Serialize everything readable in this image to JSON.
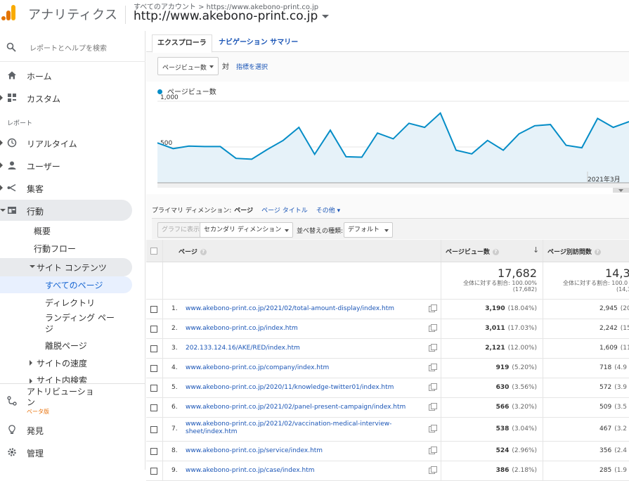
{
  "header": {
    "app_title": "アナリティクス",
    "breadcrumb": "すべてのアカウント > https://www.akebono-print.co.jp",
    "account": "http://www.akebono-print.co.jp"
  },
  "sidebar": {
    "search_placeholder": "レポートとヘルプを検索",
    "home": "ホーム",
    "custom": "カスタム",
    "section_label": "レポート",
    "realtime": "リアルタイム",
    "users": "ユーザー",
    "acquisition": "集客",
    "behavior": "行動",
    "overview": "概要",
    "behavior_flow": "行動フロー",
    "site_content": "サイト コンテンツ",
    "all_pages": "すべてのページ",
    "directory": "ディレクトリ",
    "landing_line1": "ランディング ペー",
    "landing_line2": "ジ",
    "exit_pages": "離脱ページ",
    "site_speed": "サイトの速度",
    "site_search": "サイト内検索",
    "attribution_line1": "アトリビューショ",
    "attribution_line2": "ン",
    "beta": "ベータ版",
    "discover": "発見",
    "admin": "管理"
  },
  "tabs": {
    "explorer": "エクスプローラ",
    "navigation": "ナビゲーション サマリー"
  },
  "metric": {
    "selected": "ページビュー数",
    "vs": "対",
    "select_metric": "指標を選択"
  },
  "chart_data": {
    "type": "line",
    "legend": "ページビュー数",
    "color": "#058dc7",
    "y_ticks": [
      "1,000",
      "500"
    ],
    "ylim": [
      0,
      1000
    ],
    "x_label": "2021年3月",
    "values": [
      490,
      420,
      450,
      445,
      445,
      300,
      290,
      410,
      520,
      680,
      350,
      645,
      320,
      315,
      610,
      540,
      730,
      680,
      855,
      400,
      355,
      520,
      400,
      600,
      700,
      715,
      460,
      430,
      790,
      680,
      750
    ]
  },
  "dims": {
    "label": "プライマリ ディメンション:",
    "current": "ページ",
    "page_title": "ページ タイトル",
    "other": "その他"
  },
  "toolbar": {
    "graph": "グラフに表示",
    "secondary": "セカンダリ ディメンション",
    "sort_label": "並べ替えの種類:",
    "sort_default": "デフォルト"
  },
  "table": {
    "col_page": "ページ",
    "col_pv": "ページビュー数",
    "col_upv": "ページ別訪問数",
    "total_pv": "17,682",
    "total_pv_sub": "全体に対する割合: 100.00%",
    "total_pv_sub2": "(17,682)",
    "total_upv": "14,38",
    "total_upv_sub": "全体に対する割合: 100.0",
    "total_upv_sub2": "(14,3",
    "rows": [
      {
        "idx": "1.",
        "url": "www.akebono-print.co.jp/2021/02/total-amount-display/index.htm",
        "pv": "3,190",
        "pct": "(18.04%)",
        "upv": "2,945",
        "upct": "(20.4"
      },
      {
        "idx": "2.",
        "url": "www.akebono-print.co.jp/index.htm",
        "pv": "3,011",
        "pct": "(17.03%)",
        "upv": "2,242",
        "upct": "(15.5"
      },
      {
        "idx": "3.",
        "url": "202.133.124.16/AKE/RED/index.htm",
        "pv": "2,121",
        "pct": "(12.00%)",
        "upv": "1,609",
        "upct": "(11.1"
      },
      {
        "idx": "4.",
        "url": "www.akebono-print.co.jp/company/index.htm",
        "pv": "919",
        "pct": "(5.20%)",
        "upv": "718",
        "upct": "(4.9"
      },
      {
        "idx": "5.",
        "url": "www.akebono-print.co.jp/2020/11/knowledge-twitter01/index.htm",
        "pv": "630",
        "pct": "(3.56%)",
        "upv": "572",
        "upct": "(3.9"
      },
      {
        "idx": "6.",
        "url": "www.akebono-print.co.jp/2021/02/panel-present-campaign/index.htm",
        "pv": "566",
        "pct": "(3.20%)",
        "upv": "509",
        "upct": "(3.5"
      },
      {
        "idx": "7.",
        "url": "www.akebono-print.co.jp/2021/02/vaccination-medical-interview-sheet/index.htm",
        "pv": "538",
        "pct": "(3.04%)",
        "upv": "467",
        "upct": "(3.2"
      },
      {
        "idx": "8.",
        "url": "www.akebono-print.co.jp/service/index.htm",
        "pv": "524",
        "pct": "(2.96%)",
        "upv": "356",
        "upct": "(2.4"
      },
      {
        "idx": "9.",
        "url": "www.akebono-print.co.jp/case/index.htm",
        "pv": "386",
        "pct": "(2.18%)",
        "upv": "285",
        "upct": "(1.9"
      }
    ]
  }
}
